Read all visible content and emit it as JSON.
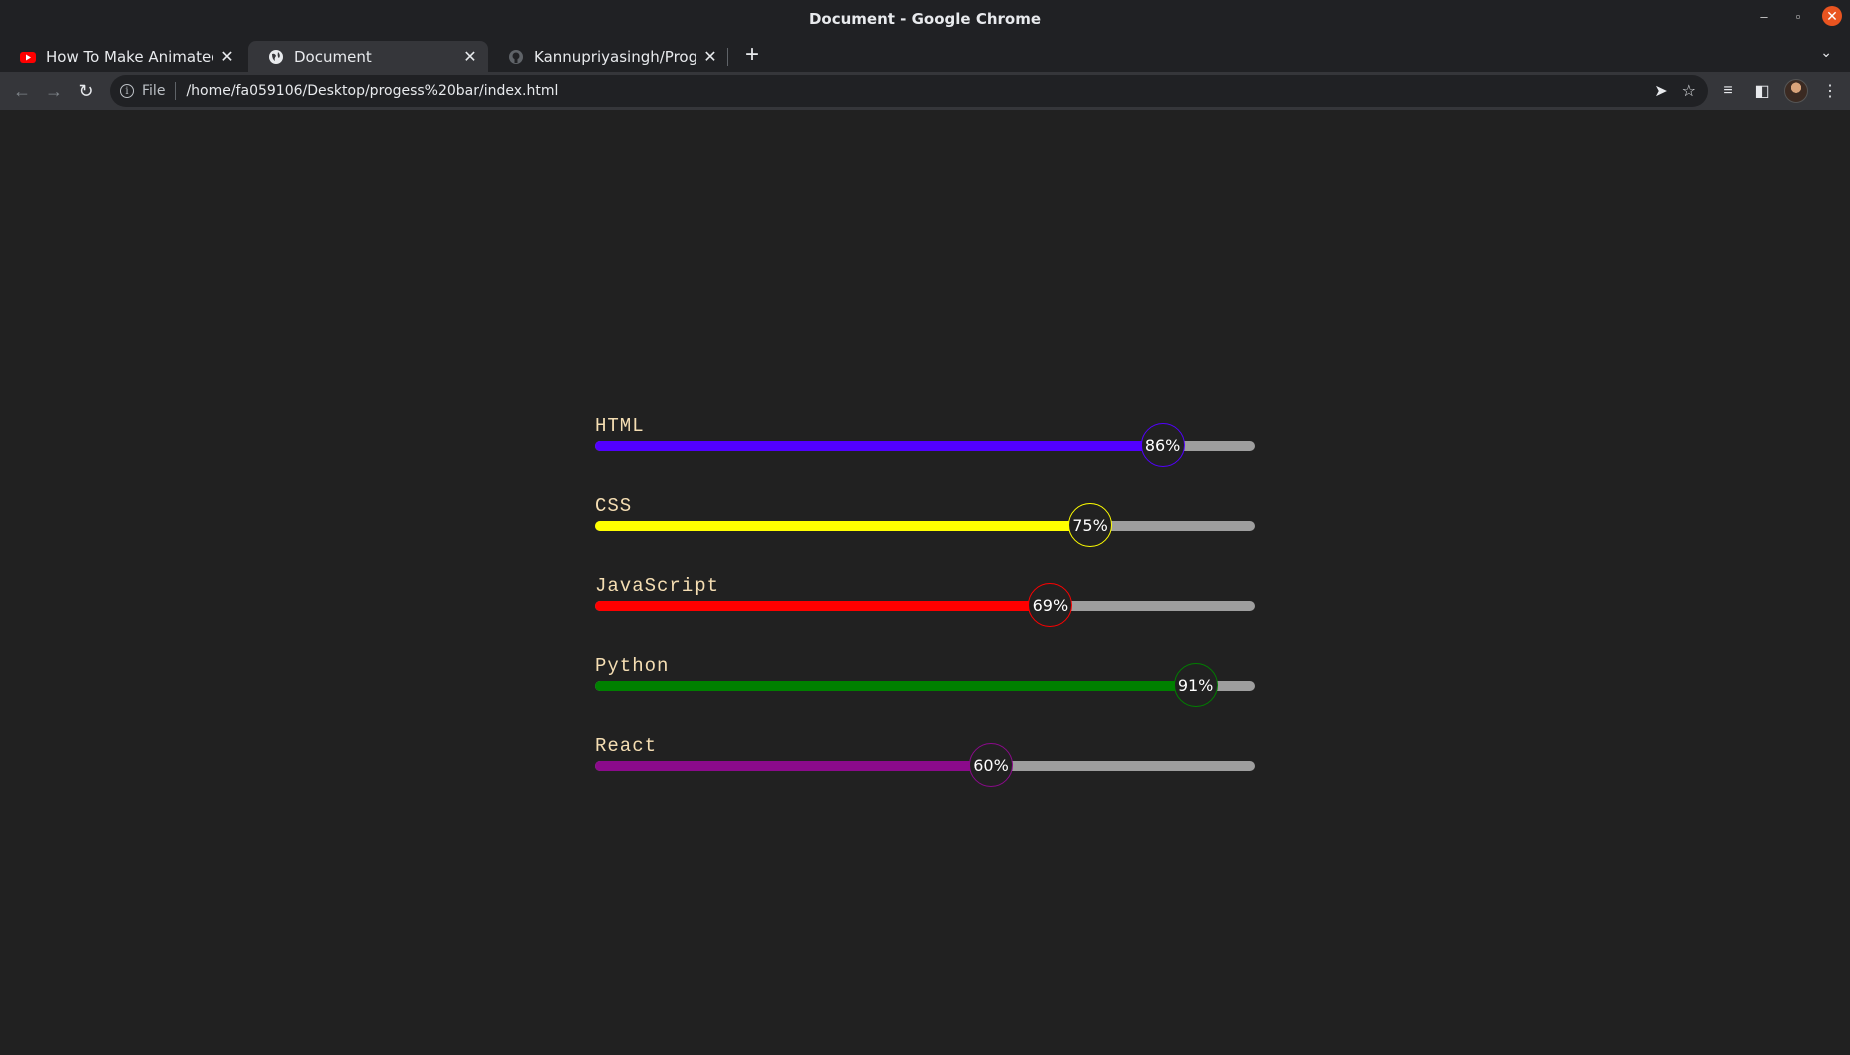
{
  "window": {
    "title": "Document - Google Chrome"
  },
  "tabs": [
    {
      "label": "How To Make Animated P",
      "icon": "youtube-icon",
      "active": false
    },
    {
      "label": "Document",
      "icon": "globe-icon",
      "active": true
    },
    {
      "label": "Kannupriyasingh/Progre",
      "icon": "github-icon",
      "active": false
    }
  ],
  "address_bar": {
    "scheme_label": "File",
    "url": "/home/fa059106/Desktop/progess%20bar/index.html"
  },
  "skills": [
    {
      "label": "HTML",
      "percent_text": "86%",
      "value": 0.86,
      "color": "#5200ff"
    },
    {
      "label": "CSS",
      "percent_text": "75%",
      "value": 0.75,
      "color": "#ffff00"
    },
    {
      "label": "JavaScript",
      "percent_text": "69%",
      "value": 0.69,
      "color": "#ff0000"
    },
    {
      "label": "Python",
      "percent_text": "91%",
      "value": 0.91,
      "color": "#008000"
    },
    {
      "label": "React",
      "percent_text": "60%",
      "value": 0.6,
      "color": "#8b0a8b"
    }
  ],
  "colors": {
    "page_background": "#212121",
    "label_color": "#f5deb3",
    "track_color": "#9e9e9e"
  }
}
